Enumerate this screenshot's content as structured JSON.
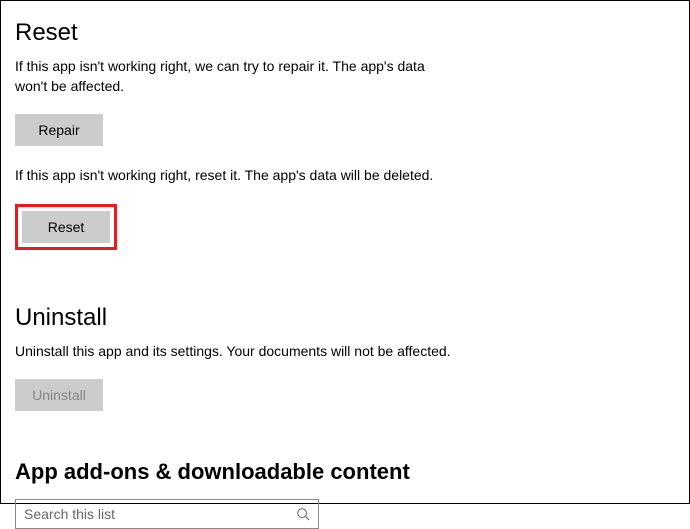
{
  "reset": {
    "heading": "Reset",
    "repair_desc": "If this app isn't working right, we can try to repair it. The app's data won't be affected.",
    "repair_label": "Repair",
    "reset_desc": "If this app isn't working right, reset it. The app's data will be deleted.",
    "reset_label": "Reset"
  },
  "uninstall": {
    "heading": "Uninstall",
    "desc": "Uninstall this app and its settings. Your documents will not be affected.",
    "label": "Uninstall"
  },
  "addons": {
    "heading": "App add-ons & downloadable content",
    "search_placeholder": "Search this list"
  }
}
